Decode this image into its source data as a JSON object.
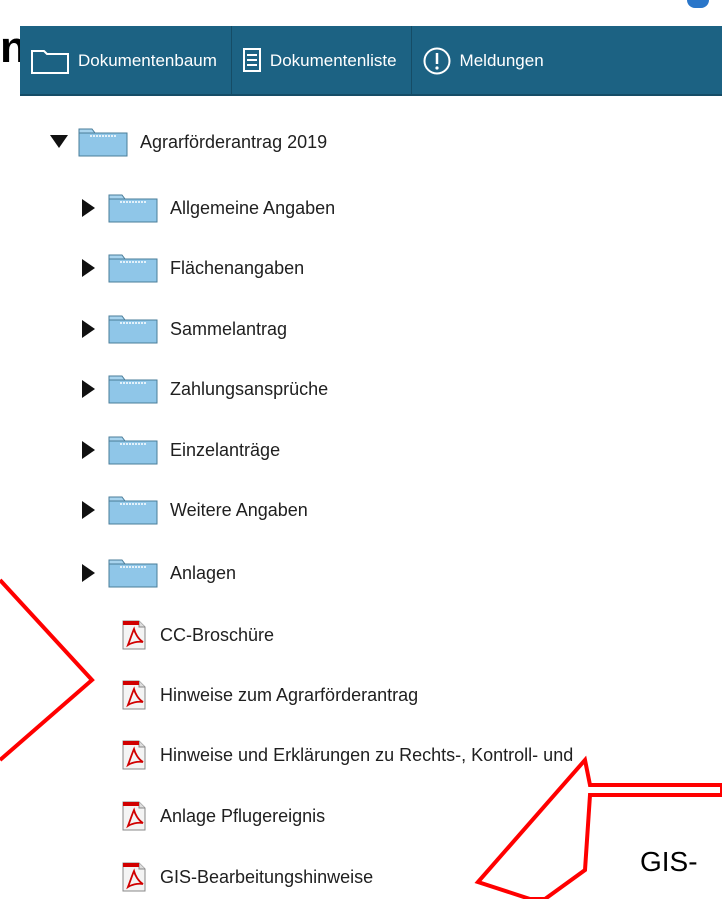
{
  "header_fragment": "n",
  "toolbar": {
    "buttons": [
      {
        "label": "Dokumentenbaum",
        "icon": "folder-outline-icon"
      },
      {
        "label": "Dokumentenliste",
        "icon": "list-document-icon"
      },
      {
        "label": "Meldungen",
        "icon": "exclamation-circle-icon"
      }
    ]
  },
  "tree": {
    "root": {
      "label": "Agrarförderantrag 2019",
      "expanded": true
    },
    "folders": [
      {
        "label": "Allgemeine Angaben"
      },
      {
        "label": "Flächenangaben"
      },
      {
        "label": "Sammelantrag"
      },
      {
        "label": "Zahlungsansprüche"
      },
      {
        "label": "Einzelanträge"
      },
      {
        "label": "Weitere Angaben"
      },
      {
        "label": "Anlagen"
      }
    ],
    "documents": [
      {
        "label": "CC-Broschüre"
      },
      {
        "label": "Hinweise zum Agrarförderantrag"
      },
      {
        "label": "Hinweise und Erklärungen zu Rechts-, Kontroll- und"
      },
      {
        "label": "Anlage Pflugereignis"
      },
      {
        "label": "GIS-Bearbeitungshinweise"
      }
    ]
  },
  "annotation": {
    "text": "GIS-",
    "color": "#ff0000"
  },
  "colors": {
    "toolbar_bg": "#1c6283",
    "folder_fill": "#8fc6e8",
    "pdf_red": "#d10000",
    "annotation": "#ff0000"
  }
}
